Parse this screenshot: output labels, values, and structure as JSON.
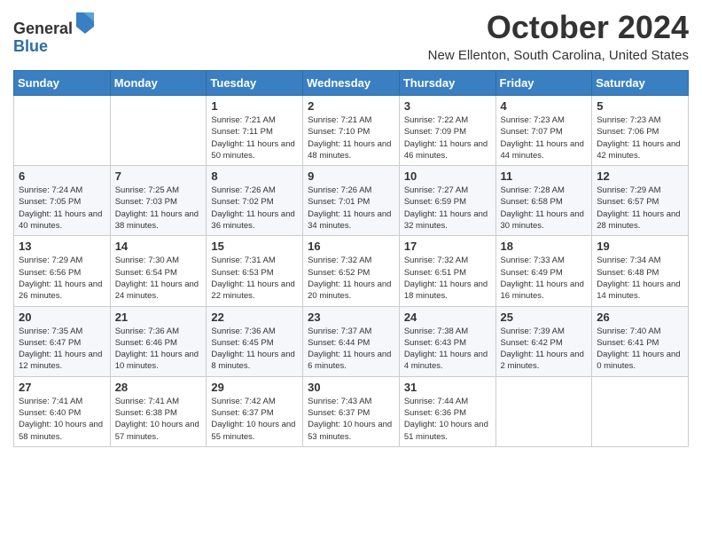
{
  "header": {
    "logo_general": "General",
    "logo_blue": "Blue",
    "month_title": "October 2024",
    "location": "New Ellenton, South Carolina, United States"
  },
  "days_of_week": [
    "Sunday",
    "Monday",
    "Tuesday",
    "Wednesday",
    "Thursday",
    "Friday",
    "Saturday"
  ],
  "weeks": [
    [
      {
        "day": "",
        "info": ""
      },
      {
        "day": "",
        "info": ""
      },
      {
        "day": "1",
        "info": "Sunrise: 7:21 AM\nSunset: 7:11 PM\nDaylight: 11 hours and 50 minutes."
      },
      {
        "day": "2",
        "info": "Sunrise: 7:21 AM\nSunset: 7:10 PM\nDaylight: 11 hours and 48 minutes."
      },
      {
        "day": "3",
        "info": "Sunrise: 7:22 AM\nSunset: 7:09 PM\nDaylight: 11 hours and 46 minutes."
      },
      {
        "day": "4",
        "info": "Sunrise: 7:23 AM\nSunset: 7:07 PM\nDaylight: 11 hours and 44 minutes."
      },
      {
        "day": "5",
        "info": "Sunrise: 7:23 AM\nSunset: 7:06 PM\nDaylight: 11 hours and 42 minutes."
      }
    ],
    [
      {
        "day": "6",
        "info": "Sunrise: 7:24 AM\nSunset: 7:05 PM\nDaylight: 11 hours and 40 minutes."
      },
      {
        "day": "7",
        "info": "Sunrise: 7:25 AM\nSunset: 7:03 PM\nDaylight: 11 hours and 38 minutes."
      },
      {
        "day": "8",
        "info": "Sunrise: 7:26 AM\nSunset: 7:02 PM\nDaylight: 11 hours and 36 minutes."
      },
      {
        "day": "9",
        "info": "Sunrise: 7:26 AM\nSunset: 7:01 PM\nDaylight: 11 hours and 34 minutes."
      },
      {
        "day": "10",
        "info": "Sunrise: 7:27 AM\nSunset: 6:59 PM\nDaylight: 11 hours and 32 minutes."
      },
      {
        "day": "11",
        "info": "Sunrise: 7:28 AM\nSunset: 6:58 PM\nDaylight: 11 hours and 30 minutes."
      },
      {
        "day": "12",
        "info": "Sunrise: 7:29 AM\nSunset: 6:57 PM\nDaylight: 11 hours and 28 minutes."
      }
    ],
    [
      {
        "day": "13",
        "info": "Sunrise: 7:29 AM\nSunset: 6:56 PM\nDaylight: 11 hours and 26 minutes."
      },
      {
        "day": "14",
        "info": "Sunrise: 7:30 AM\nSunset: 6:54 PM\nDaylight: 11 hours and 24 minutes."
      },
      {
        "day": "15",
        "info": "Sunrise: 7:31 AM\nSunset: 6:53 PM\nDaylight: 11 hours and 22 minutes."
      },
      {
        "day": "16",
        "info": "Sunrise: 7:32 AM\nSunset: 6:52 PM\nDaylight: 11 hours and 20 minutes."
      },
      {
        "day": "17",
        "info": "Sunrise: 7:32 AM\nSunset: 6:51 PM\nDaylight: 11 hours and 18 minutes."
      },
      {
        "day": "18",
        "info": "Sunrise: 7:33 AM\nSunset: 6:49 PM\nDaylight: 11 hours and 16 minutes."
      },
      {
        "day": "19",
        "info": "Sunrise: 7:34 AM\nSunset: 6:48 PM\nDaylight: 11 hours and 14 minutes."
      }
    ],
    [
      {
        "day": "20",
        "info": "Sunrise: 7:35 AM\nSunset: 6:47 PM\nDaylight: 11 hours and 12 minutes."
      },
      {
        "day": "21",
        "info": "Sunrise: 7:36 AM\nSunset: 6:46 PM\nDaylight: 11 hours and 10 minutes."
      },
      {
        "day": "22",
        "info": "Sunrise: 7:36 AM\nSunset: 6:45 PM\nDaylight: 11 hours and 8 minutes."
      },
      {
        "day": "23",
        "info": "Sunrise: 7:37 AM\nSunset: 6:44 PM\nDaylight: 11 hours and 6 minutes."
      },
      {
        "day": "24",
        "info": "Sunrise: 7:38 AM\nSunset: 6:43 PM\nDaylight: 11 hours and 4 minutes."
      },
      {
        "day": "25",
        "info": "Sunrise: 7:39 AM\nSunset: 6:42 PM\nDaylight: 11 hours and 2 minutes."
      },
      {
        "day": "26",
        "info": "Sunrise: 7:40 AM\nSunset: 6:41 PM\nDaylight: 11 hours and 0 minutes."
      }
    ],
    [
      {
        "day": "27",
        "info": "Sunrise: 7:41 AM\nSunset: 6:40 PM\nDaylight: 10 hours and 58 minutes."
      },
      {
        "day": "28",
        "info": "Sunrise: 7:41 AM\nSunset: 6:38 PM\nDaylight: 10 hours and 57 minutes."
      },
      {
        "day": "29",
        "info": "Sunrise: 7:42 AM\nSunset: 6:37 PM\nDaylight: 10 hours and 55 minutes."
      },
      {
        "day": "30",
        "info": "Sunrise: 7:43 AM\nSunset: 6:37 PM\nDaylight: 10 hours and 53 minutes."
      },
      {
        "day": "31",
        "info": "Sunrise: 7:44 AM\nSunset: 6:36 PM\nDaylight: 10 hours and 51 minutes."
      },
      {
        "day": "",
        "info": ""
      },
      {
        "day": "",
        "info": ""
      }
    ]
  ]
}
